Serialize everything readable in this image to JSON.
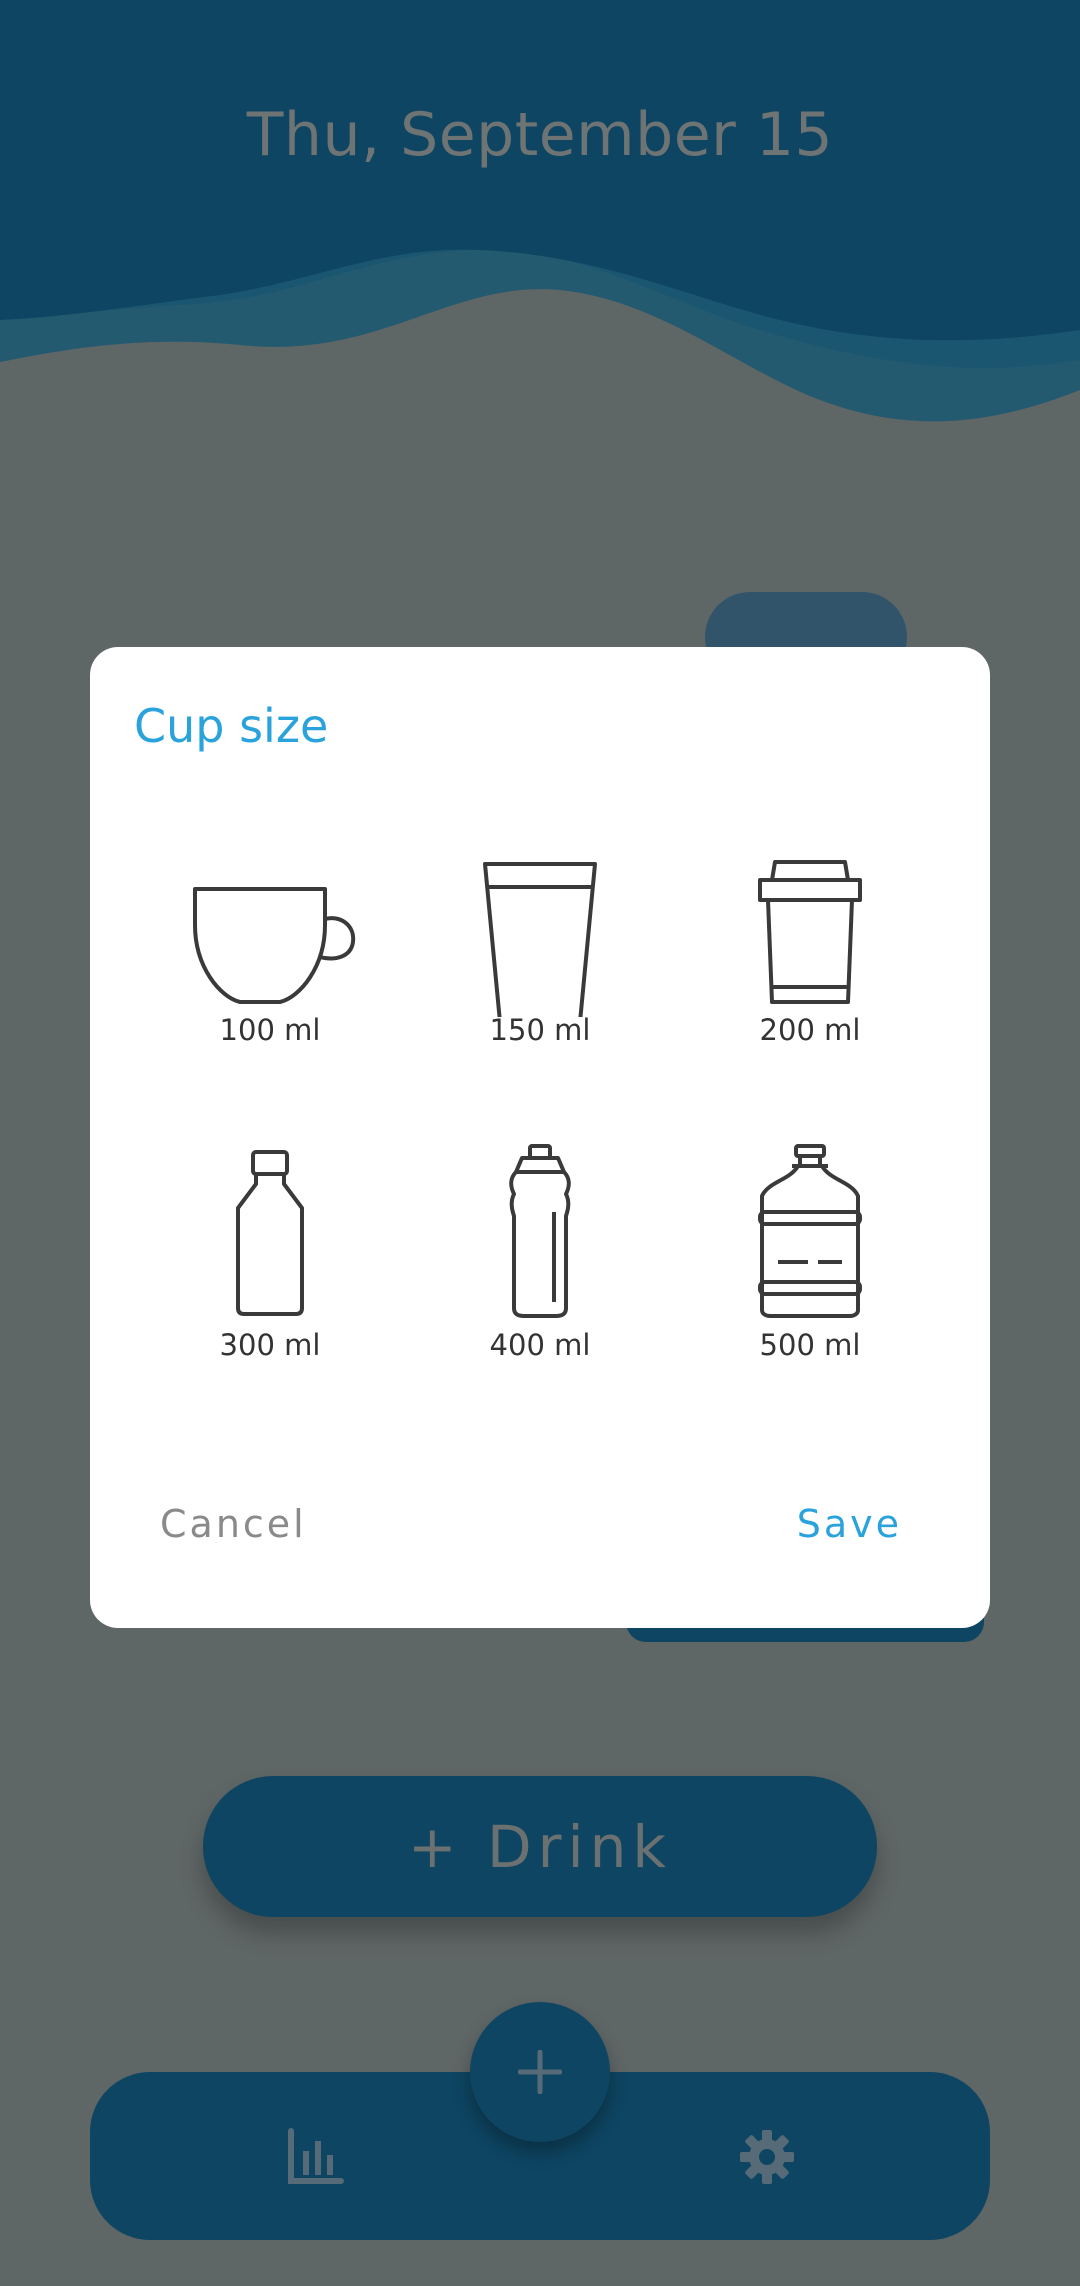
{
  "header": {
    "date": "Thu, September 15"
  },
  "drink_button": {
    "label": "+ Drink"
  },
  "dialog": {
    "title": "Cup size",
    "cups": [
      {
        "label": "100 ml",
        "icon": "coffee-cup-icon"
      },
      {
        "label": "150 ml",
        "icon": "glass-icon"
      },
      {
        "label": "200 ml",
        "icon": "takeaway-cup-icon"
      },
      {
        "label": "300 ml",
        "icon": "bottle-icon"
      },
      {
        "label": "400 ml",
        "icon": "sports-bottle-icon"
      },
      {
        "label": "500 ml",
        "icon": "water-jug-icon"
      }
    ],
    "cancel_label": "Cancel",
    "save_label": "Save"
  },
  "bottom_nav": {
    "items": [
      {
        "icon": "bar-chart-icon"
      },
      {
        "icon": "plus-icon"
      },
      {
        "icon": "gear-icon"
      }
    ]
  },
  "colors": {
    "overlay_background": "#5f6666",
    "primary_dark": "#0e4562",
    "accent": "#2aa2dc",
    "dialog_background": "#ffffff"
  }
}
